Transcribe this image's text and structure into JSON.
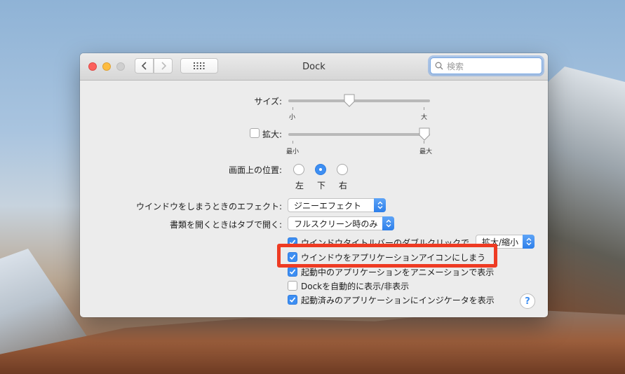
{
  "window": {
    "title": "Dock"
  },
  "search": {
    "placeholder": "検索"
  },
  "size": {
    "label": "サイズ:",
    "min_label": "小",
    "max_label": "大",
    "level": 0.43
  },
  "magnification": {
    "checked": false,
    "label": "拡大:",
    "min_label": "最小",
    "max_label": "最大",
    "level": 1.0
  },
  "position": {
    "label": "画面上の位置:",
    "options": [
      "左",
      "下",
      "右"
    ],
    "selected": "下"
  },
  "minimize_effect": {
    "label": "ウインドウをしまうときのエフェクト:",
    "value": "ジニーエフェクト"
  },
  "open_documents_tabs": {
    "label": "書類を開くときはタブで開く:",
    "value": "フルスクリーン時のみ"
  },
  "double_click": {
    "checked": true,
    "label": "ウインドウタイトルバーのダブルクリックで",
    "value": "拡大/縮小"
  },
  "checkboxes": [
    {
      "label": "ウインドウをアプリケーションアイコンにしまう",
      "checked": true
    },
    {
      "label": "起動中のアプリケーションをアニメーションで表示",
      "checked": true
    },
    {
      "label": "Dockを自動的に表示/非表示",
      "checked": false
    },
    {
      "label": "起動済みのアプリケーションにインジケータを表示",
      "checked": true
    }
  ],
  "help": {
    "label": "?"
  },
  "colors": {
    "accent": "#3d8ef2",
    "highlight": "#ee3b23"
  }
}
